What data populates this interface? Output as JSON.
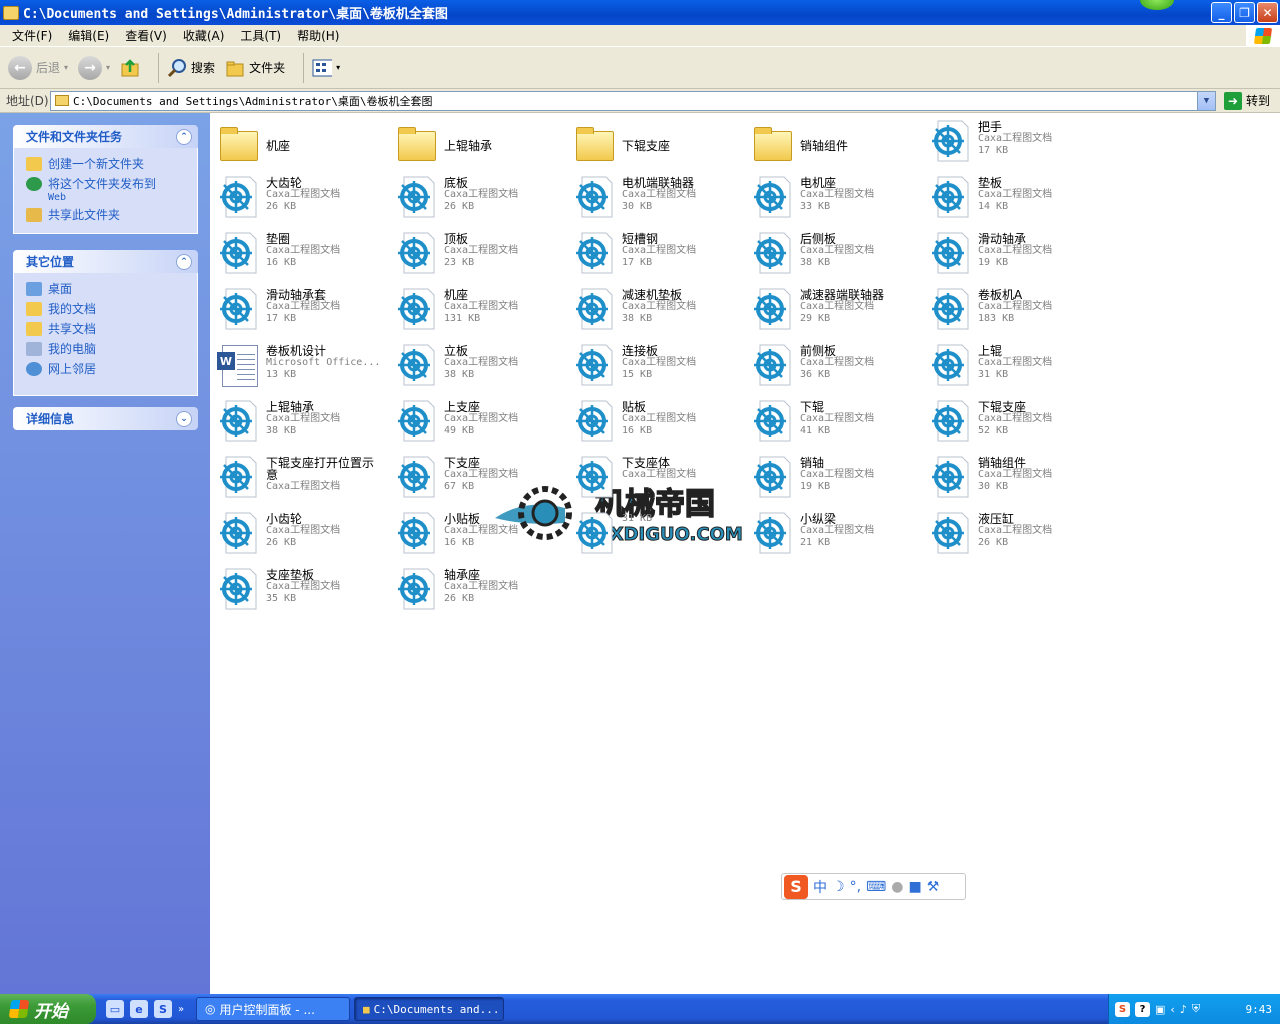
{
  "window": {
    "title": "C:\\Documents and Settings\\Administrator\\桌面\\卷板机全套图",
    "buttons": {
      "minimize": "_",
      "maximize": "❐",
      "close": "✕"
    }
  },
  "menu": [
    "文件(F)",
    "编辑(E)",
    "查看(V)",
    "收藏(A)",
    "工具(T)",
    "帮助(H)"
  ],
  "toolbar": {
    "back": "后退",
    "search": "搜索",
    "folders": "文件夹"
  },
  "address": {
    "label": "地址(D)",
    "value": "C:\\Documents and Settings\\Administrator\\桌面\\卷板机全套图",
    "go": "转到"
  },
  "tasks_panel": {
    "title": "文件和文件夹任务",
    "items": [
      {
        "label": "创建一个新文件夹",
        "sub": ""
      },
      {
        "label": "将这个文件夹发布到",
        "sub": "Web"
      },
      {
        "label": "共享此文件夹",
        "sub": ""
      }
    ]
  },
  "places_panel": {
    "title": "其它位置",
    "items": [
      "桌面",
      "我的文档",
      "共享文档",
      "我的电脑",
      "网上邻居"
    ]
  },
  "details_panel": {
    "title": "详细信息"
  },
  "files": [
    {
      "name": "机座",
      "type": "",
      "size": "",
      "kind": "folder"
    },
    {
      "name": "上辊轴承",
      "type": "",
      "size": "",
      "kind": "folder"
    },
    {
      "name": "下辊支座",
      "type": "",
      "size": "",
      "kind": "folder"
    },
    {
      "name": "销轴组件",
      "type": "",
      "size": "",
      "kind": "folder"
    },
    {
      "name": "把手",
      "type": "Caxa工程图文档",
      "size": "17 KB",
      "kind": "caxa"
    },
    {
      "name": "大齿轮",
      "type": "Caxa工程图文档",
      "size": "26 KB",
      "kind": "caxa"
    },
    {
      "name": "底板",
      "type": "Caxa工程图文档",
      "size": "26 KB",
      "kind": "caxa"
    },
    {
      "name": "电机端联轴器",
      "type": "Caxa工程图文档",
      "size": "30 KB",
      "kind": "caxa"
    },
    {
      "name": "电机座",
      "type": "Caxa工程图文档",
      "size": "33 KB",
      "kind": "caxa"
    },
    {
      "name": "垫板",
      "type": "Caxa工程图文档",
      "size": "14 KB",
      "kind": "caxa"
    },
    {
      "name": "垫圈",
      "type": "Caxa工程图文档",
      "size": "16 KB",
      "kind": "caxa"
    },
    {
      "name": "顶板",
      "type": "Caxa工程图文档",
      "size": "23 KB",
      "kind": "caxa"
    },
    {
      "name": "短槽钢",
      "type": "Caxa工程图文档",
      "size": "17 KB",
      "kind": "caxa"
    },
    {
      "name": "后侧板",
      "type": "Caxa工程图文档",
      "size": "38 KB",
      "kind": "caxa"
    },
    {
      "name": "滑动轴承",
      "type": "Caxa工程图文档",
      "size": "19 KB",
      "kind": "caxa"
    },
    {
      "name": "滑动轴承套",
      "type": "Caxa工程图文档",
      "size": "17 KB",
      "kind": "caxa"
    },
    {
      "name": "机座",
      "type": "Caxa工程图文档",
      "size": "131 KB",
      "kind": "caxa"
    },
    {
      "name": "减速机垫板",
      "type": "Caxa工程图文档",
      "size": "38 KB",
      "kind": "caxa"
    },
    {
      "name": "减速器端联轴器",
      "type": "Caxa工程图文档",
      "size": "29 KB",
      "kind": "caxa"
    },
    {
      "name": "卷板机A",
      "type": "Caxa工程图文档",
      "size": "183 KB",
      "kind": "caxa"
    },
    {
      "name": "卷板机设计",
      "type": "Microsoft Office...",
      "size": "13 KB",
      "kind": "word"
    },
    {
      "name": "立板",
      "type": "Caxa工程图文档",
      "size": "38 KB",
      "kind": "caxa"
    },
    {
      "name": "连接板",
      "type": "Caxa工程图文档",
      "size": "15 KB",
      "kind": "caxa"
    },
    {
      "name": "前侧板",
      "type": "Caxa工程图文档",
      "size": "36 KB",
      "kind": "caxa"
    },
    {
      "name": "上辊",
      "type": "Caxa工程图文档",
      "size": "31 KB",
      "kind": "caxa"
    },
    {
      "name": "上辊轴承",
      "type": "Caxa工程图文档",
      "size": "38 KB",
      "kind": "caxa"
    },
    {
      "name": "上支座",
      "type": "Caxa工程图文档",
      "size": "49 KB",
      "kind": "caxa"
    },
    {
      "name": "贴板",
      "type": "Caxa工程图文档",
      "size": "16 KB",
      "kind": "caxa"
    },
    {
      "name": "下辊",
      "type": "Caxa工程图文档",
      "size": "41 KB",
      "kind": "caxa"
    },
    {
      "name": "下辊支座",
      "type": "Caxa工程图文档",
      "size": "52 KB",
      "kind": "caxa"
    },
    {
      "name": "下辊支座打开位置示意",
      "type": "Caxa工程图文档",
      "size": "",
      "kind": "caxa"
    },
    {
      "name": "下支座",
      "type": "Caxa工程图文档",
      "size": "67 KB",
      "kind": "caxa"
    },
    {
      "name": "下支座体",
      "type": "Caxa工程图文档",
      "size": "",
      "kind": "caxa"
    },
    {
      "name": "销轴",
      "type": "Caxa工程图文档",
      "size": "19 KB",
      "kind": "caxa"
    },
    {
      "name": "销轴组件",
      "type": "Caxa工程图文档",
      "size": "30 KB",
      "kind": "caxa"
    },
    {
      "name": "小齿轮",
      "type": "Caxa工程图文档",
      "size": "26 KB",
      "kind": "caxa"
    },
    {
      "name": "小贴板",
      "type": "Caxa工程图文档",
      "size": "16 KB",
      "kind": "caxa"
    },
    {
      "name": "",
      "type": "",
      "size": "31 KB",
      "kind": "caxa"
    },
    {
      "name": "小纵梁",
      "type": "Caxa工程图文档",
      "size": "21 KB",
      "kind": "caxa"
    },
    {
      "name": "液压缸",
      "type": "Caxa工程图文档",
      "size": "26 KB",
      "kind": "caxa"
    },
    {
      "name": "支座垫板",
      "type": "Caxa工程图文档",
      "size": "35 KB",
      "kind": "caxa"
    },
    {
      "name": "轴承座",
      "type": "Caxa工程图文档",
      "size": "26 KB",
      "kind": "caxa"
    }
  ],
  "watermark": {
    "cn": "机械帝国",
    "en": "JXDIGUO.COM"
  },
  "ime": {
    "mode": "中"
  },
  "taskbar": {
    "start": "开始",
    "tasks": [
      "用户控制面板 - ...",
      "C:\\Documents and..."
    ],
    "clock": "9:43"
  },
  "colors": {
    "title_blue": "#0a5fe6",
    "left_pane": "#7ba2e7",
    "link_blue": "#215dc6",
    "caxa_blue": "#1f8fc9"
  }
}
